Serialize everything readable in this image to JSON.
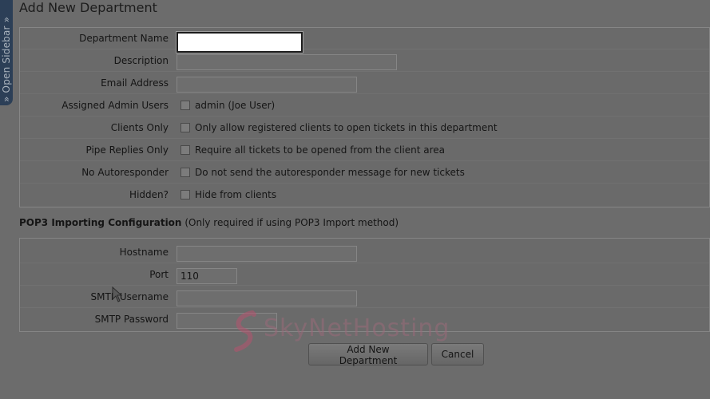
{
  "sidebar": {
    "open_label": "» Open Sidebar »"
  },
  "page": {
    "title": "Add New Department"
  },
  "form": {
    "department_name": {
      "label": "Department Name",
      "value": ""
    },
    "description": {
      "label": "Description",
      "value": ""
    },
    "email_address": {
      "label": "Email Address",
      "value": ""
    },
    "assigned_admin_users": {
      "label": "Assigned Admin Users",
      "option": "admin (Joe User)",
      "checked": false
    },
    "clients_only": {
      "label": "Clients Only",
      "option": "Only allow registered clients to open tickets in this department",
      "checked": false
    },
    "pipe_replies_only": {
      "label": "Pipe Replies Only",
      "option": "Require all tickets to be opened from the client area",
      "checked": false
    },
    "no_autoresponder": {
      "label": "No Autoresponder",
      "option": "Do not send the autoresponder message for new tickets",
      "checked": false
    },
    "hidden": {
      "label": "Hidden?",
      "option": "Hide from clients",
      "checked": false
    }
  },
  "pop3": {
    "heading": "POP3 Importing Configuration",
    "note": "(Only required if using POP3 Import method)",
    "hostname": {
      "label": "Hostname",
      "value": ""
    },
    "port": {
      "label": "Port",
      "value": "110"
    },
    "smtp_username": {
      "label": "SMTP Username",
      "value": ""
    },
    "smtp_password": {
      "label": "SMTP Password",
      "value": ""
    }
  },
  "buttons": {
    "submit": "Add New Department",
    "cancel": "Cancel"
  },
  "watermark": {
    "text": "SkyNetHosting"
  },
  "colors": {
    "overlay": "#6c6c6c",
    "sidebar": "#2c3f57",
    "watermark": "#b5546e"
  }
}
